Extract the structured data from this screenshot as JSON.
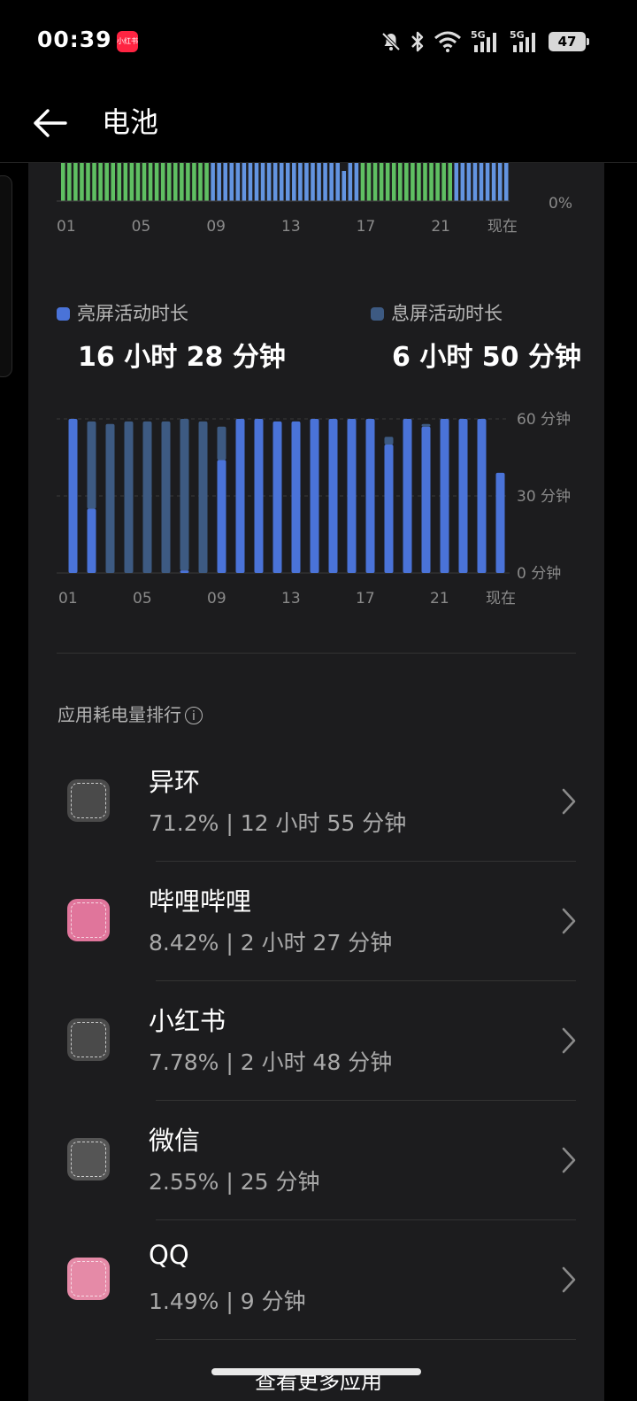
{
  "status_bar": {
    "time": "00:39",
    "notification_app": "小红书",
    "battery_level": "47"
  },
  "header": {
    "title": "电池"
  },
  "legend": {
    "screen_on": {
      "label": "亮屏活动时长",
      "value": "16 小时 28 分钟",
      "color": "#4a73d8"
    },
    "screen_off": {
      "label": "息屏活动时长",
      "value": "6 小时 50 分钟",
      "color": "#3d5a82"
    }
  },
  "chart_data": [
    {
      "type": "bar",
      "title": "",
      "categories": [
        "01",
        "02",
        "03",
        "04",
        "05",
        "06",
        "07",
        "08",
        "09",
        "10",
        "11",
        "12",
        "13",
        "14",
        "15",
        "16",
        "17",
        "18",
        "19",
        "20",
        "21",
        "22",
        "23",
        "现在"
      ],
      "x_tick_labels": [
        "01",
        "05",
        "09",
        "13",
        "17",
        "21",
        "现在"
      ],
      "series": [
        {
          "values": [
            1,
            1,
            1,
            1,
            1,
            1,
            1,
            1,
            0,
            0,
            0,
            0,
            0,
            0,
            0,
            0,
            1,
            1,
            1,
            1,
            1,
            0,
            0,
            0
          ]
        },
        {
          "values": [
            0,
            0,
            0,
            0,
            0,
            0,
            0,
            0,
            1,
            1,
            1,
            1,
            1,
            1,
            1,
            1,
            0,
            0,
            0,
            0,
            0,
            1,
            1,
            1
          ]
        }
      ],
      "colors": [
        "#5fbf62",
        "#6394e0"
      ],
      "y_tick_labels": [
        "0%"
      ],
      "note": "partially scrolled battery level chart"
    },
    {
      "type": "bar",
      "categories": [
        "01",
        "02",
        "03",
        "04",
        "05",
        "06",
        "07",
        "08",
        "09",
        "10",
        "11",
        "12",
        "13",
        "14",
        "15",
        "16",
        "17",
        "18",
        "19",
        "20",
        "21",
        "22",
        "23",
        "现在"
      ],
      "x_tick_labels": [
        "01",
        "05",
        "09",
        "13",
        "17",
        "21",
        "现在"
      ],
      "y_tick_labels": [
        "60 分钟",
        "30 分钟",
        "0 分钟"
      ],
      "ylim": [
        0,
        60
      ],
      "stacked": true,
      "series": [
        {
          "name": "亮屏活动时长",
          "values": [
            60,
            25,
            0,
            0,
            0,
            0,
            1,
            0,
            44,
            60,
            60,
            59,
            59,
            60,
            60,
            60,
            60,
            50,
            60,
            57,
            60,
            60,
            60,
            39
          ]
        },
        {
          "name": "息屏活动时长",
          "values": [
            0,
            34,
            58,
            59,
            59,
            59,
            59,
            59,
            13,
            0,
            0,
            0,
            0,
            0,
            0,
            0,
            0,
            3,
            0,
            1,
            0,
            0,
            0,
            0
          ]
        }
      ],
      "grid": true
    }
  ],
  "ranking": {
    "title": "应用耗电量排行",
    "apps": [
      {
        "name": "异环",
        "stat": "71.2% | 12 小时 55 分钟",
        "icon": "yihuan-icon",
        "color": "#4a4a4a"
      },
      {
        "name": "哔哩哔哩",
        "stat": "8.42% | 2 小时 27 分钟",
        "icon": "bilibili-icon",
        "color": "#e0759b"
      },
      {
        "name": "小红书",
        "stat": "7.78% | 2 小时 48 分钟",
        "icon": "xiaohongshu-icon",
        "color": "#4a4a4a"
      },
      {
        "name": "微信",
        "stat": "2.55% | 25 分钟",
        "icon": "wechat-icon",
        "color": "#555555"
      },
      {
        "name": "QQ",
        "stat": "1.49% | 9 分钟",
        "icon": "qq-icon",
        "color": "#e58aa7"
      }
    ],
    "more_label": "查看更多应用"
  }
}
